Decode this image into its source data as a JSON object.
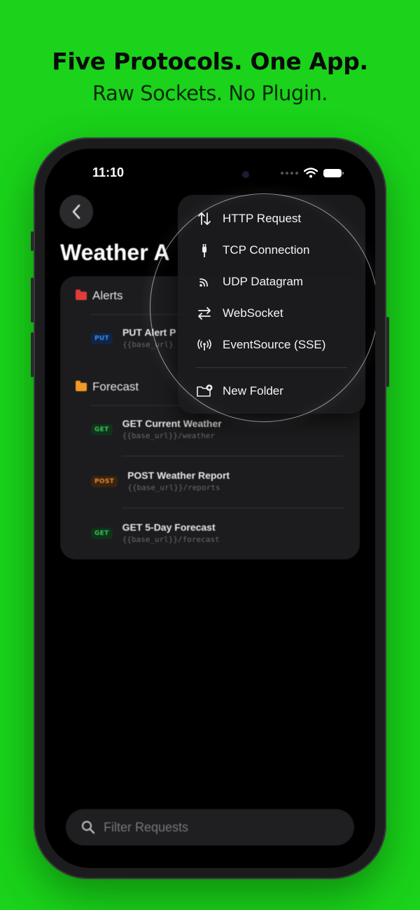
{
  "promo": {
    "headline": "Five Protocols. One App.",
    "subline": "Raw Sockets. No Plugin."
  },
  "status_bar": {
    "time": "11:10"
  },
  "page": {
    "title": "Weather A",
    "folders": [
      {
        "name": "Alerts",
        "color": "#e23b3b",
        "requests": [
          {
            "method": "PUT",
            "name": "PUT Alert P",
            "url": "{{base_url}"
          }
        ]
      },
      {
        "name": "Forecast",
        "color": "#f29a25",
        "requests": [
          {
            "method": "GET",
            "name": "GET Current Weather",
            "url": "{{base_url}}/weather"
          },
          {
            "method": "POST",
            "name": "POST Weather Report",
            "url": "{{base_url}}/reports"
          },
          {
            "method": "GET",
            "name": "GET 5-Day Forecast",
            "url": "{{base_url}}/forecast"
          }
        ]
      }
    ]
  },
  "menu": {
    "items": [
      {
        "label": "HTTP Request",
        "icon": "arrows-up-down-icon"
      },
      {
        "label": "TCP Connection",
        "icon": "plug-icon"
      },
      {
        "label": "UDP Datagram",
        "icon": "rss-icon"
      },
      {
        "label": "WebSocket",
        "icon": "arrows-left-right-icon"
      },
      {
        "label": "EventSource (SSE)",
        "icon": "antenna-icon"
      }
    ],
    "folder_item": {
      "label": "New Folder",
      "icon": "folder-plus-icon"
    }
  },
  "search": {
    "placeholder": "Filter Requests"
  },
  "colors": {
    "background": "#1ad31a",
    "accent": "#ffffff"
  }
}
